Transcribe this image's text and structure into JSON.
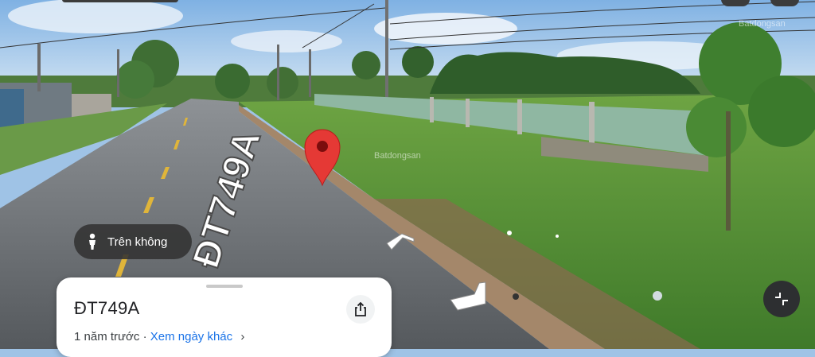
{
  "street_label": "ĐT749A",
  "watermark": "Batdongsan",
  "aerial_button": {
    "label": "Trên không"
  },
  "info_card": {
    "title": "ĐT749A",
    "date_text": "1 năm trước",
    "separator": "·",
    "other_dates_link": "Xem ngày khác",
    "chevron": "›"
  },
  "icons": {
    "person": "person-icon",
    "share": "share-icon",
    "fullscreen": "collapse-icon",
    "pin": "location-pin-icon"
  },
  "colors": {
    "pin": "#e53935",
    "link": "#1a73e8",
    "dark_button": "#2d2f31"
  }
}
